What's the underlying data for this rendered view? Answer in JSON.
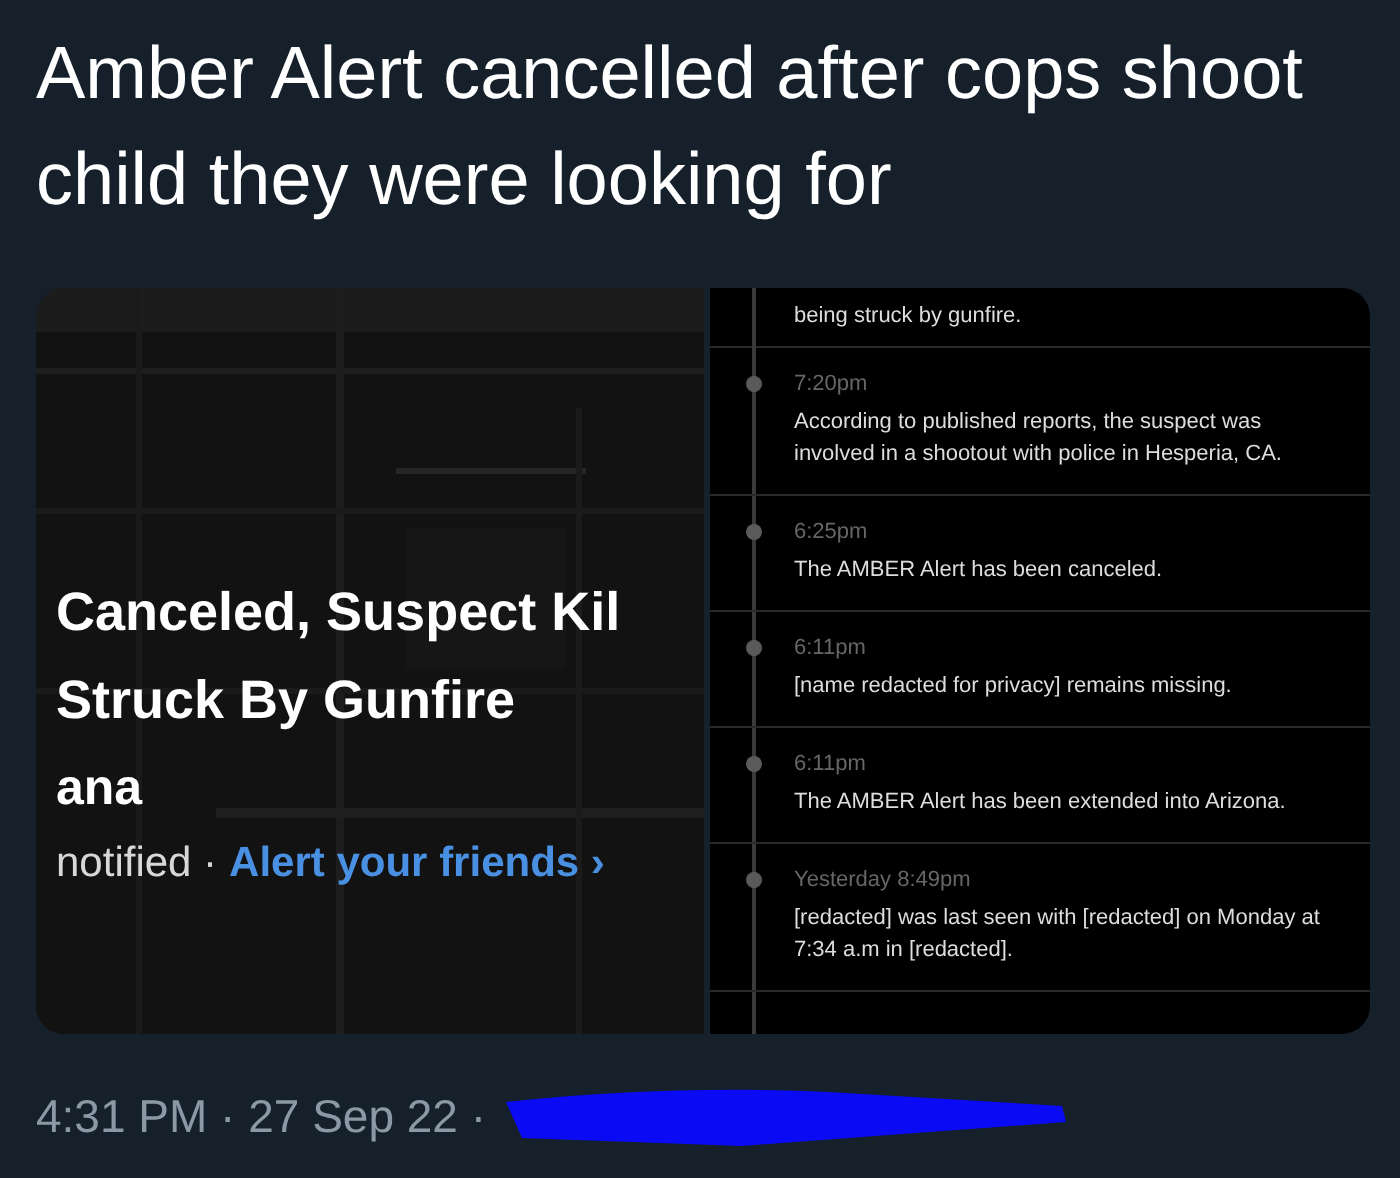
{
  "tweet": {
    "text": "Amber Alert cancelled after cops shoot child they were looking for",
    "footer": "4:31 PM · 27 Sep 22 ·"
  },
  "alert_card": {
    "headline_lines": [
      "Canceled, Suspect Kil",
      "Struck By Gunfire"
    ],
    "place": "ana",
    "notified": "notified ·",
    "link": "Alert your friends ›"
  },
  "timeline": {
    "top_fragment": "being struck by gunfire.",
    "entries": [
      {
        "time": "7:20pm",
        "text": "According to published reports, the suspect was involved in a shootout with police in Hesperia, CA."
      },
      {
        "time": "6:25pm",
        "text": "The AMBER Alert has been canceled."
      },
      {
        "time": "6:11pm",
        "text": "[name redacted for privacy] remains missing."
      },
      {
        "time": "6:11pm",
        "text": "The AMBER Alert has been extended into Arizona."
      },
      {
        "time": "Yesterday 8:49pm",
        "text": "[redacted] was last seen with [redacted] on Monday at 7:34 a.m in [redacted]."
      }
    ]
  }
}
